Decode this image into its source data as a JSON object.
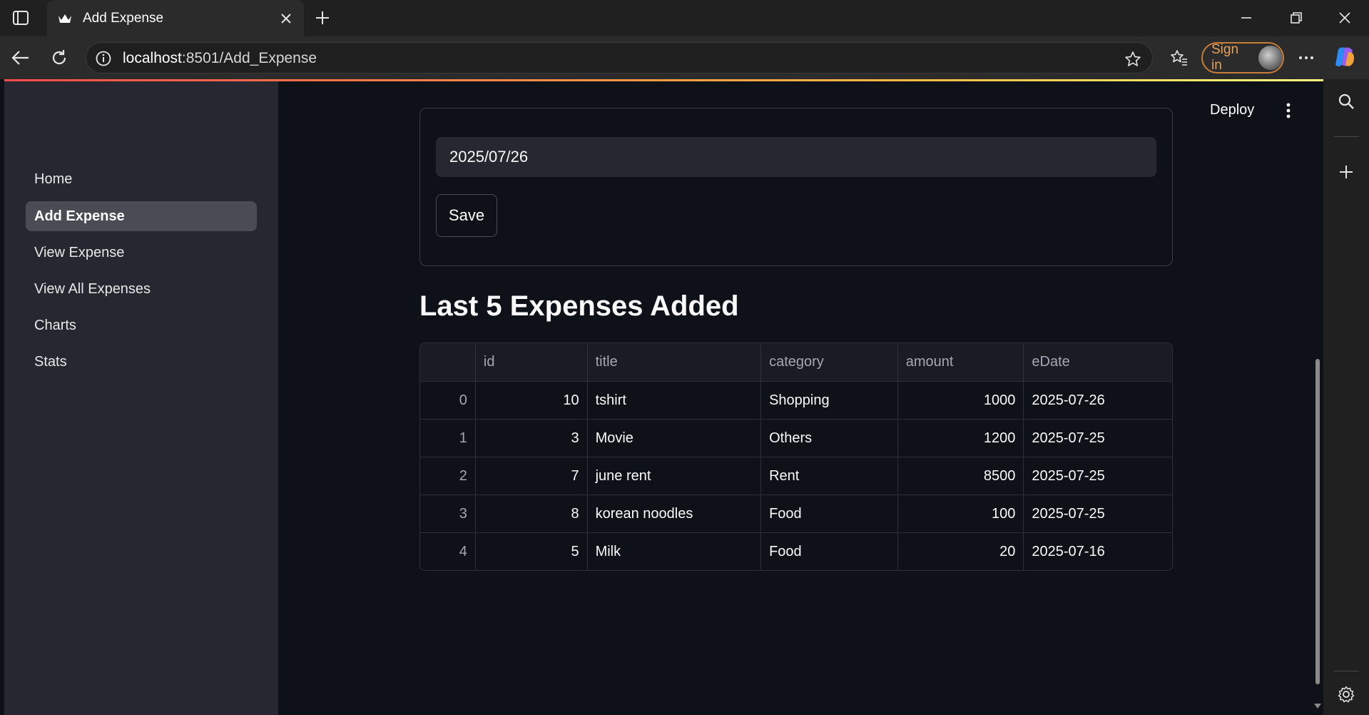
{
  "browser": {
    "tab_title": "Add Expense",
    "url_host": "localhost",
    "url_rest": ":8501/Add_Expense",
    "signin_label": "Sign in"
  },
  "header": {
    "deploy_label": "Deploy"
  },
  "sidebar": {
    "items": [
      {
        "label": "Home",
        "active": false
      },
      {
        "label": "Add Expense",
        "active": true
      },
      {
        "label": "View Expense",
        "active": false
      },
      {
        "label": "View All Expenses",
        "active": false
      },
      {
        "label": "Charts",
        "active": false
      },
      {
        "label": "Stats",
        "active": false
      }
    ]
  },
  "form": {
    "date_value": "2025/07/26",
    "save_label": "Save"
  },
  "section": {
    "title": "Last 5 Expenses Added"
  },
  "table": {
    "columns": [
      "",
      "id",
      "title",
      "category",
      "amount",
      "eDate"
    ],
    "rows": [
      {
        "index": "0",
        "id": "10",
        "title": "tshirt",
        "category": "Shopping",
        "amount": "1000",
        "eDate": "2025-07-26"
      },
      {
        "index": "1",
        "id": "3",
        "title": "Movie",
        "category": "Others",
        "amount": "1200",
        "eDate": "2025-07-25"
      },
      {
        "index": "2",
        "id": "7",
        "title": "june rent",
        "category": "Rent",
        "amount": "8500",
        "eDate": "2025-07-25"
      },
      {
        "index": "3",
        "id": "8",
        "title": "korean noodles",
        "category": "Food",
        "amount": "100",
        "eDate": "2025-07-25"
      },
      {
        "index": "4",
        "id": "5",
        "title": "Milk",
        "category": "Food",
        "amount": "20",
        "eDate": "2025-07-16"
      }
    ]
  },
  "colors": {
    "app_bg": "#0e1117",
    "sidebar_bg": "#262730",
    "active_item_bg": "#4a4b55",
    "signin_accent": "#c87d39"
  }
}
